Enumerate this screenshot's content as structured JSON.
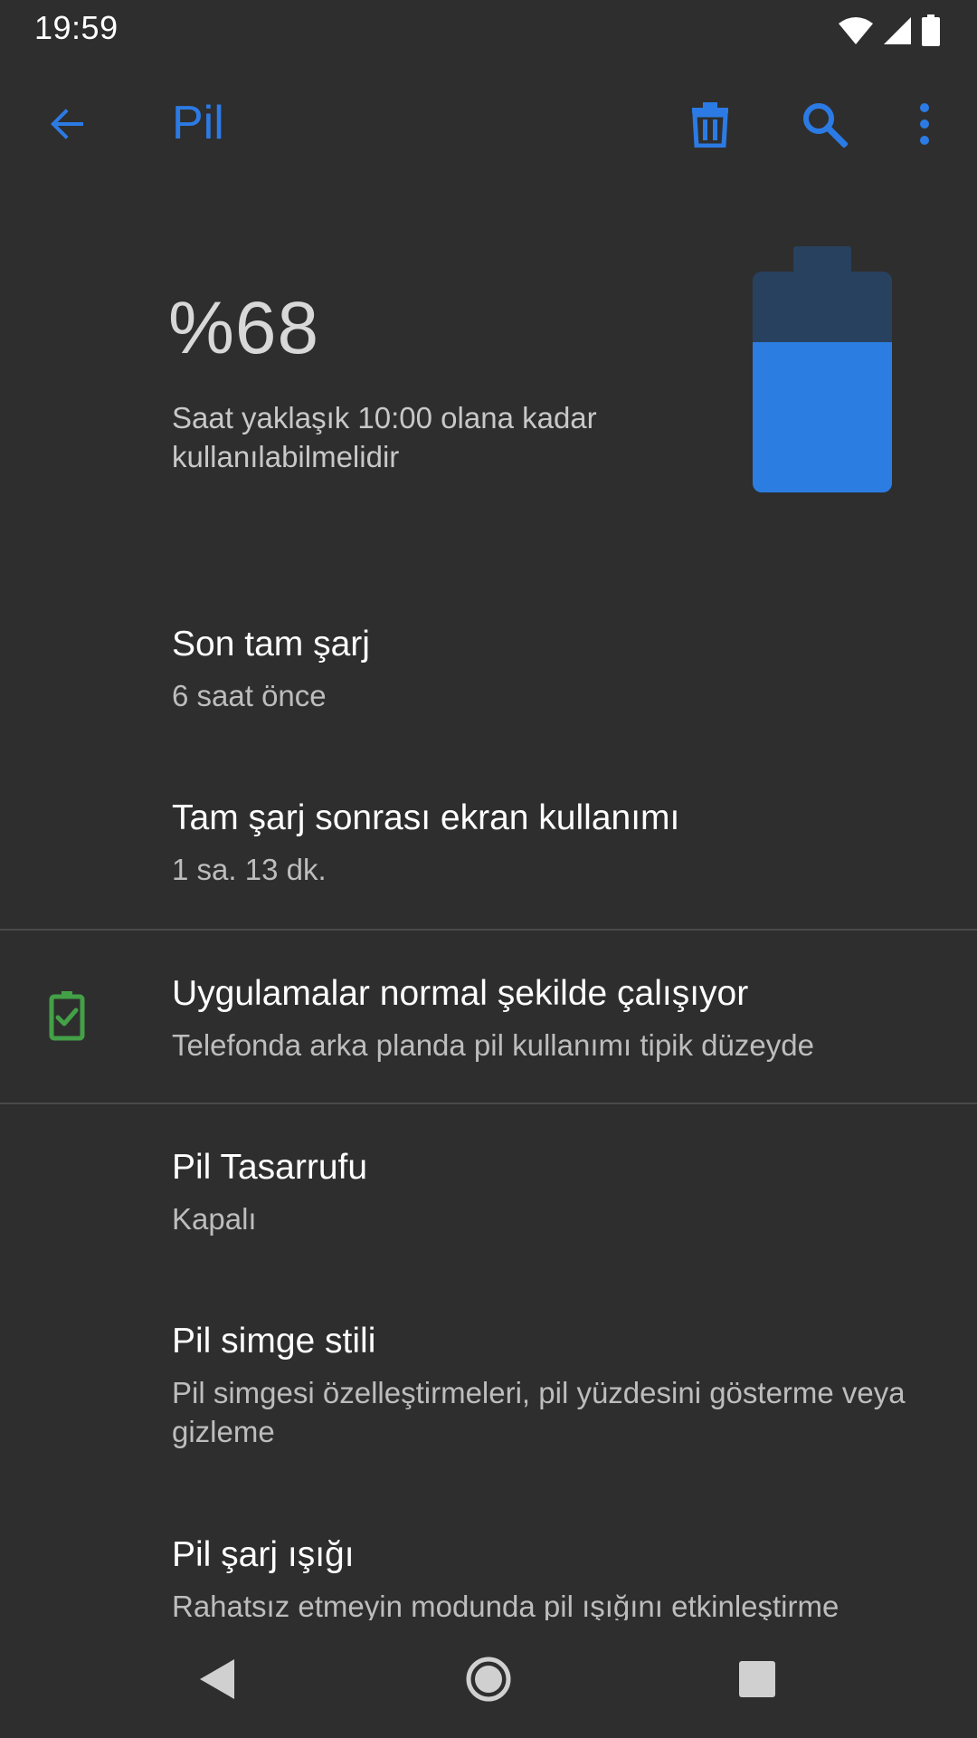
{
  "status_bar": {
    "time": "19:59",
    "icons": [
      "wifi-icon",
      "signal-icon",
      "battery-icon"
    ]
  },
  "app_bar": {
    "title": "Pil",
    "accent_color": "#2c7be5",
    "actions": [
      "arrow-back-icon",
      "delete-icon",
      "search-icon",
      "more-vert-icon"
    ]
  },
  "battery": {
    "percent_label": "%68",
    "level_percent": 68,
    "estimate": "Saat yaklaşık 10:00 olana kadar kullanılabilmelidir"
  },
  "items": [
    {
      "title": "Son tam şarj",
      "subtitle": "6 saat önce"
    },
    {
      "title": "Tam şarj sonrası ekran kullanımı",
      "subtitle": "1 sa. 13 dk."
    },
    {
      "title": "Uygulamalar normal şekilde çalışıyor",
      "subtitle": "Telefonda arka planda pil kullanımı tipik düzeyde",
      "icon": "battery-check-icon",
      "icon_color": "#43a047"
    },
    {
      "title": "Pil Tasarrufu",
      "subtitle": "Kapalı"
    },
    {
      "title": "Pil simge stili",
      "subtitle": "Pil simgesi özelleştirmeleri, pil yüzdesini gösterme veya gizleme"
    },
    {
      "title": "Pil şarj ışığı",
      "subtitle": "Rahatsız etmeyin modunda pil ışığını etkinleştirme"
    }
  ],
  "nav_bar": {
    "buttons": [
      "nav-back-icon",
      "nav-home-icon",
      "nav-recents-icon"
    ]
  }
}
